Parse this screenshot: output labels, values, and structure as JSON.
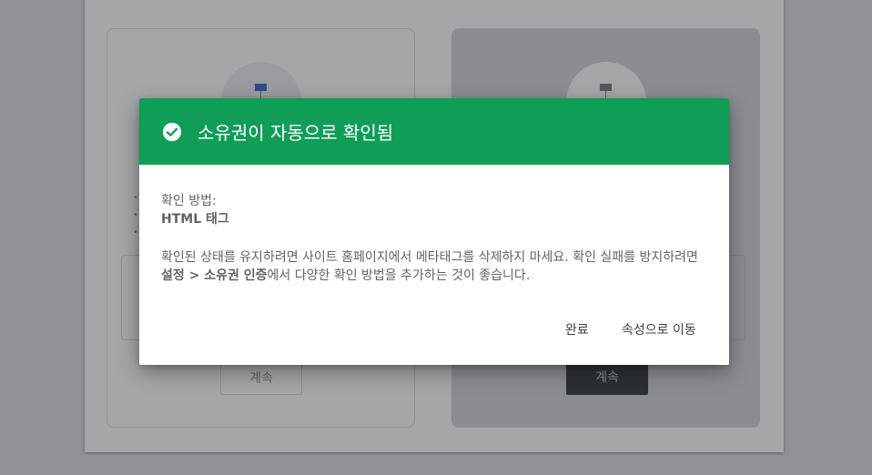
{
  "background": {
    "left_card": {
      "continue_label": "계속",
      "dots": "•\n•\n•"
    },
    "right_card": {
      "continue_label": "계속"
    }
  },
  "dialog": {
    "title": "소유권이 자동으로 확인됨",
    "header_color": "#0f9d58",
    "method_label": "확인 방법:",
    "method_value": "HTML 태그",
    "description_part1": "확인된 상태를 유지하려면 사이트 홈페이지에서 메타태그를 삭제하지 마세요. 확인 실패를 방지하려면 ",
    "description_bold": "설정 > 소유권 인증",
    "description_part2": "에서 다양한 확인 방법을 추가하는 것이 좋습니다.",
    "done_label": "완료",
    "go_to_property_label": "속성으로 이동"
  },
  "icons": {
    "check": "check-circle-icon",
    "flag": "flag-icon"
  }
}
